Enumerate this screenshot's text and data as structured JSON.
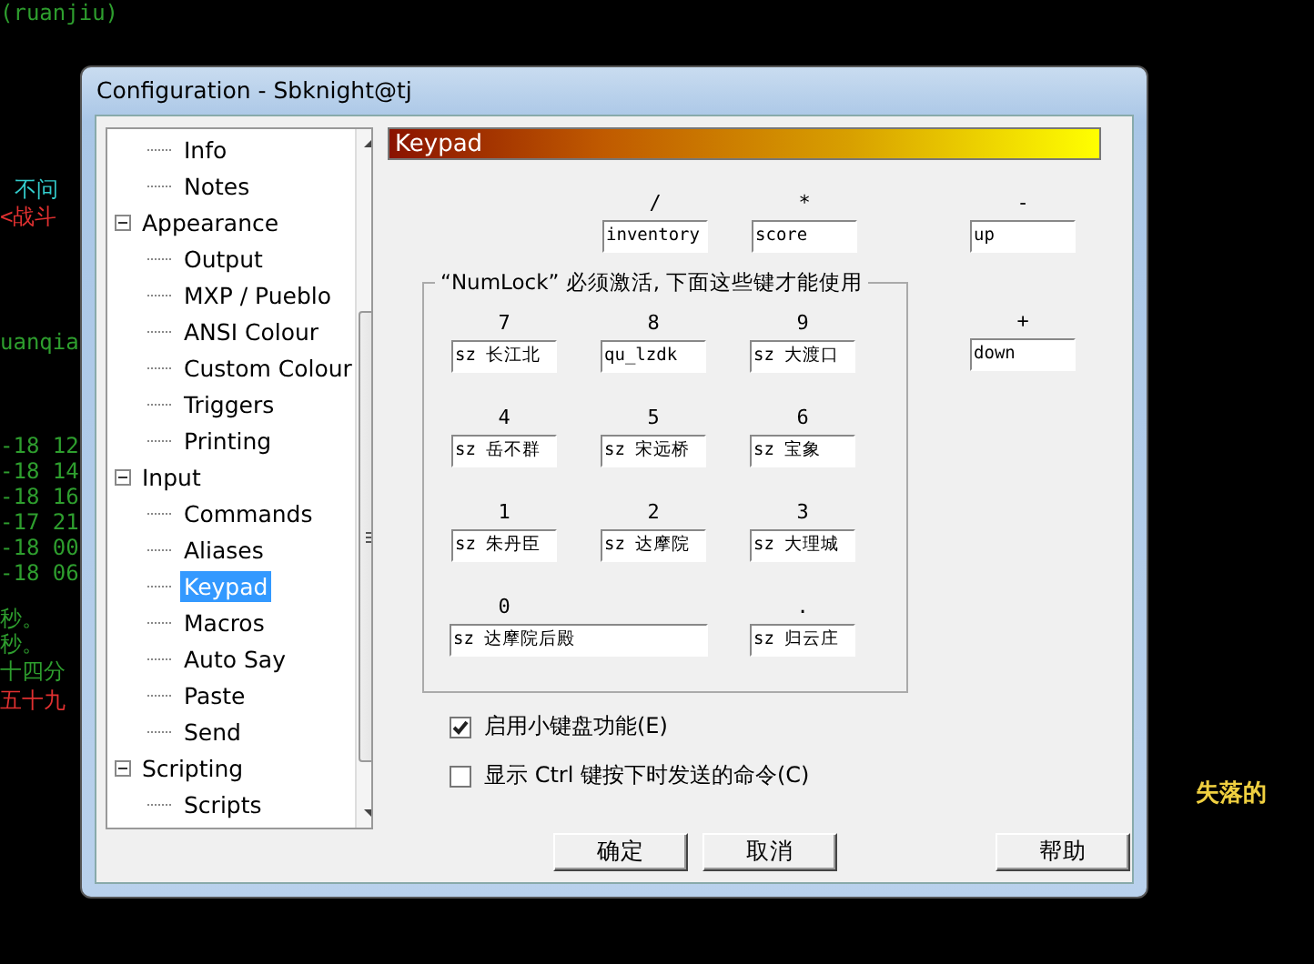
{
  "terminal_lines": [
    {
      "text": "(ruanjiu)",
      "color": "#2e9e2e"
    },
    {
      "text": "不问",
      "color": "#33cccc"
    },
    {
      "text": "<战斗",
      "color": "#e03030"
    },
    {
      "text": "uanqia",
      "color": "#2e9e2e"
    },
    {
      "text": "-18 12",
      "color": "#2e9e2e"
    },
    {
      "text": "-18 14",
      "color": "#2e9e2e"
    },
    {
      "text": "-18 16",
      "color": "#2e9e2e"
    },
    {
      "text": "-17 21",
      "color": "#2e9e2e"
    },
    {
      "text": "-18 00",
      "color": "#2e9e2e"
    },
    {
      "text": "-18 06",
      "color": "#2e9e2e"
    },
    {
      "text": "秒。",
      "color": "#2e9e2e"
    },
    {
      "text": "秒。",
      "color": "#2e9e2e"
    },
    {
      "text": "十四分",
      "color": "#2e9e2e"
    },
    {
      "text": "五十九",
      "color": "#e03030"
    },
    {
      "text": "失落的",
      "color": "#f0d040"
    }
  ],
  "window": {
    "title": "Configuration - Sbknight@tj"
  },
  "tree": [
    {
      "children": [
        {
          "label": "Info",
          "selected": false
        },
        {
          "label": "Notes",
          "selected": false
        }
      ]
    },
    {
      "label": "Appearance",
      "expanded": true,
      "children": [
        {
          "label": "Output",
          "selected": false
        },
        {
          "label": "MXP / Pueblo",
          "selected": false
        },
        {
          "label": "ANSI Colour",
          "selected": false
        },
        {
          "label": "Custom Colour",
          "selected": false
        },
        {
          "label": "Triggers",
          "selected": false
        },
        {
          "label": "Printing",
          "selected": false
        }
      ]
    },
    {
      "label": "Input",
      "expanded": true,
      "children": [
        {
          "label": "Commands",
          "selected": false
        },
        {
          "label": "Aliases",
          "selected": false
        },
        {
          "label": "Keypad",
          "selected": true
        },
        {
          "label": "Macros",
          "selected": false
        },
        {
          "label": "Auto Say",
          "selected": false
        },
        {
          "label": "Paste",
          "selected": false
        },
        {
          "label": "Send",
          "selected": false
        }
      ]
    },
    {
      "label": "Scripting",
      "expanded": true,
      "children": [
        {
          "label": "Scripts",
          "selected": false
        }
      ]
    }
  ],
  "panel_title": "Keypad",
  "top_keys": [
    {
      "label": "/",
      "value": "inventory"
    },
    {
      "label": "*",
      "value": "score"
    },
    {
      "label": "-",
      "value": "up"
    }
  ],
  "numlock_group": {
    "title": "“NumLock” 必须激活, 下面这些键才能使用",
    "keys": [
      {
        "label": "7",
        "value": "sz 长江北"
      },
      {
        "label": "8",
        "value": "qu_lzdk"
      },
      {
        "label": "9",
        "value": "sz 大渡口"
      },
      {
        "label": "4",
        "value": "sz 岳不群"
      },
      {
        "label": "5",
        "value": "sz 宋远桥"
      },
      {
        "label": "6",
        "value": "sz 宝象"
      },
      {
        "label": "1",
        "value": "sz 朱丹臣"
      },
      {
        "label": "2",
        "value": "sz 达摩院"
      },
      {
        "label": "3",
        "value": "sz 大理城"
      },
      {
        "label": "0",
        "value": "sz 达摩院后殿",
        "wide": true
      },
      {
        "label": ".",
        "value": "sz 归云庄"
      }
    ]
  },
  "side_key": {
    "label": "+",
    "value": "down"
  },
  "checkboxes": [
    {
      "label": "启用小键盘功能(E)",
      "checked": true
    },
    {
      "label": "显示 Ctrl 键按下时发送的命令(C)",
      "checked": false
    }
  ],
  "buttons": [
    "确定",
    "取消",
    "帮助"
  ]
}
